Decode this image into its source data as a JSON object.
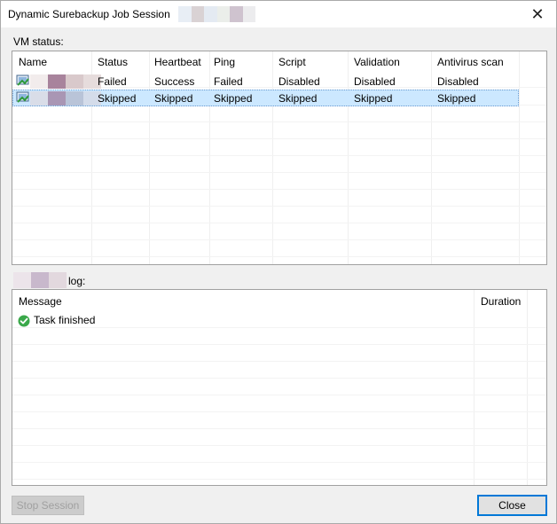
{
  "window": {
    "title": "Dynamic Surebackup Job Session"
  },
  "vm_status": {
    "label": "VM status:",
    "columns": [
      "Name",
      "Status",
      "Heartbeat",
      "Ping",
      "Script",
      "Validation",
      "Antivirus scan"
    ],
    "rows": [
      {
        "status": "Failed",
        "heartbeat": "Success",
        "ping": "Failed",
        "script": "Disabled",
        "validation": "Disabled",
        "antivirus": "Disabled"
      },
      {
        "status": "Skipped",
        "heartbeat": "Skipped",
        "ping": "Skipped",
        "script": "Skipped",
        "validation": "Skipped",
        "antivirus": "Skipped"
      }
    ]
  },
  "log": {
    "label": "log:",
    "columns": [
      "Message",
      "Duration"
    ],
    "rows": [
      {
        "message": "Task finished",
        "duration": ""
      }
    ]
  },
  "buttons": {
    "stop_session": "Stop Session",
    "close": "Close"
  },
  "icons": {
    "close": "close-icon",
    "vm": "vm-icon",
    "success": "success-check-icon"
  },
  "colors": {
    "selection": "#cce8ff",
    "success_green": "#3aa84a",
    "default_button_border": "#0078d7"
  }
}
